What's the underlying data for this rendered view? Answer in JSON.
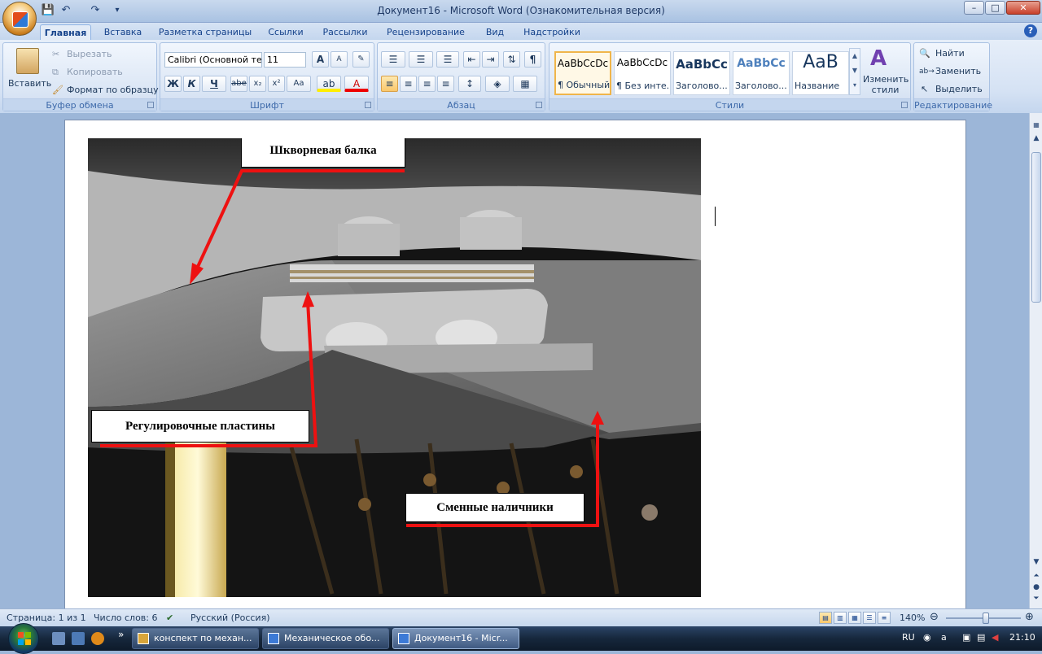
{
  "window": {
    "title": "Документ16 - Microsoft Word (Ознакомительная версия)",
    "controls": {
      "minimize": "–",
      "maximize": "□",
      "close": "✕"
    }
  },
  "quick_access": {
    "save": "💾",
    "undo": "↶",
    "redo": "↷",
    "customize": "▾"
  },
  "tabs": [
    {
      "label": "Главная",
      "active": true
    },
    {
      "label": "Вставка"
    },
    {
      "label": "Разметка страницы"
    },
    {
      "label": "Ссылки"
    },
    {
      "label": "Рассылки"
    },
    {
      "label": "Рецензирование"
    },
    {
      "label": "Вид"
    },
    {
      "label": "Надстройки"
    }
  ],
  "help_icon": "?",
  "ribbon": {
    "clipboard": {
      "label": "Буфер обмена",
      "paste": "Вставить",
      "cut": "Вырезать",
      "copy": "Копировать",
      "format_painter": "Формат по образцу"
    },
    "font": {
      "label": "Шрифт",
      "family": "Calibri (Основной текст)",
      "size": "11",
      "bold": "Ж",
      "italic": "К",
      "underline": "Ч",
      "strike": "abe",
      "subscript": "x₂",
      "superscript": "x²",
      "case": "Aa",
      "grow": "A",
      "shrink": "A"
    },
    "paragraph": {
      "label": "Абзац",
      "pilcrow": "¶"
    },
    "styles": {
      "label": "Стили",
      "items": [
        {
          "preview": "AaBbCcDc",
          "name": "¶ Обычный",
          "selected": true
        },
        {
          "preview": "AaBbCcDc",
          "name": "¶ Без инте..."
        },
        {
          "preview": "AaBbCc",
          "name": "Заголово..."
        },
        {
          "preview": "AaBbCc",
          "name": "Заголово..."
        },
        {
          "preview": "AaB",
          "name": "Название"
        }
      ],
      "change_styles": "Изменить стили"
    },
    "editing": {
      "label": "Редактирование",
      "find": "Найти",
      "replace": "Заменить",
      "select": "Выделить"
    }
  },
  "document": {
    "callouts": {
      "beam": "Шкворневая балка",
      "shims": "Регулировочные пластины",
      "liners": "Сменные наличники"
    },
    "callout_color": "#ee1111"
  },
  "status": {
    "page": "Страница: 1 из 1",
    "words": "Число слов: 6",
    "language": "Русский (Россия)",
    "zoom": "140%",
    "zoom_level": 0.5
  },
  "taskbar": {
    "items": [
      {
        "label": "конспект по механ..."
      },
      {
        "label": "Механическое обо..."
      },
      {
        "label": "Документ16 - Micr...",
        "active": true
      }
    ],
    "lang": "RU",
    "clock": "21:10",
    "chevron": "»"
  }
}
